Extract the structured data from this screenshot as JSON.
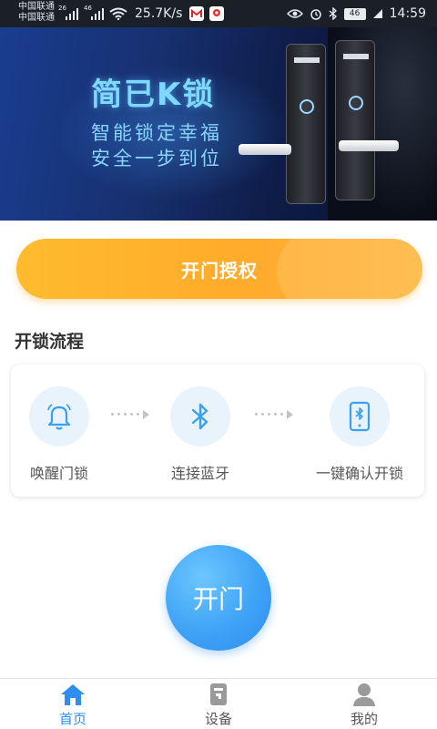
{
  "status_bar": {
    "carrier_1": "中国联通",
    "carrier_2": "中国联通",
    "net_1": "26",
    "net_2": "46",
    "speed": "25.7K/s",
    "battery": "46",
    "time": "14:59"
  },
  "banner": {
    "title": "简已K锁",
    "line_1": "智能锁定幸福",
    "line_2": "安全一步到位"
  },
  "auth_button": {
    "label": "开门授权"
  },
  "flow": {
    "title": "开锁流程",
    "steps": [
      {
        "label": "唤醒门锁",
        "icon": "bell-icon"
      },
      {
        "label": "连接蓝牙",
        "icon": "bluetooth-icon"
      },
      {
        "label": "一键确认开锁",
        "icon": "phone-bluetooth-icon"
      }
    ]
  },
  "open_button": {
    "label": "开门"
  },
  "tabs": [
    {
      "label": "首页",
      "icon": "home-icon",
      "active": true
    },
    {
      "label": "设备",
      "icon": "device-icon",
      "active": false
    },
    {
      "label": "我的",
      "icon": "user-icon",
      "active": false
    }
  ],
  "colors": {
    "accent": "#2e8def",
    "orange": "#ffb02e",
    "icon_blue": "#3aa0ef",
    "inactive_icon": "#9a9a9a"
  }
}
